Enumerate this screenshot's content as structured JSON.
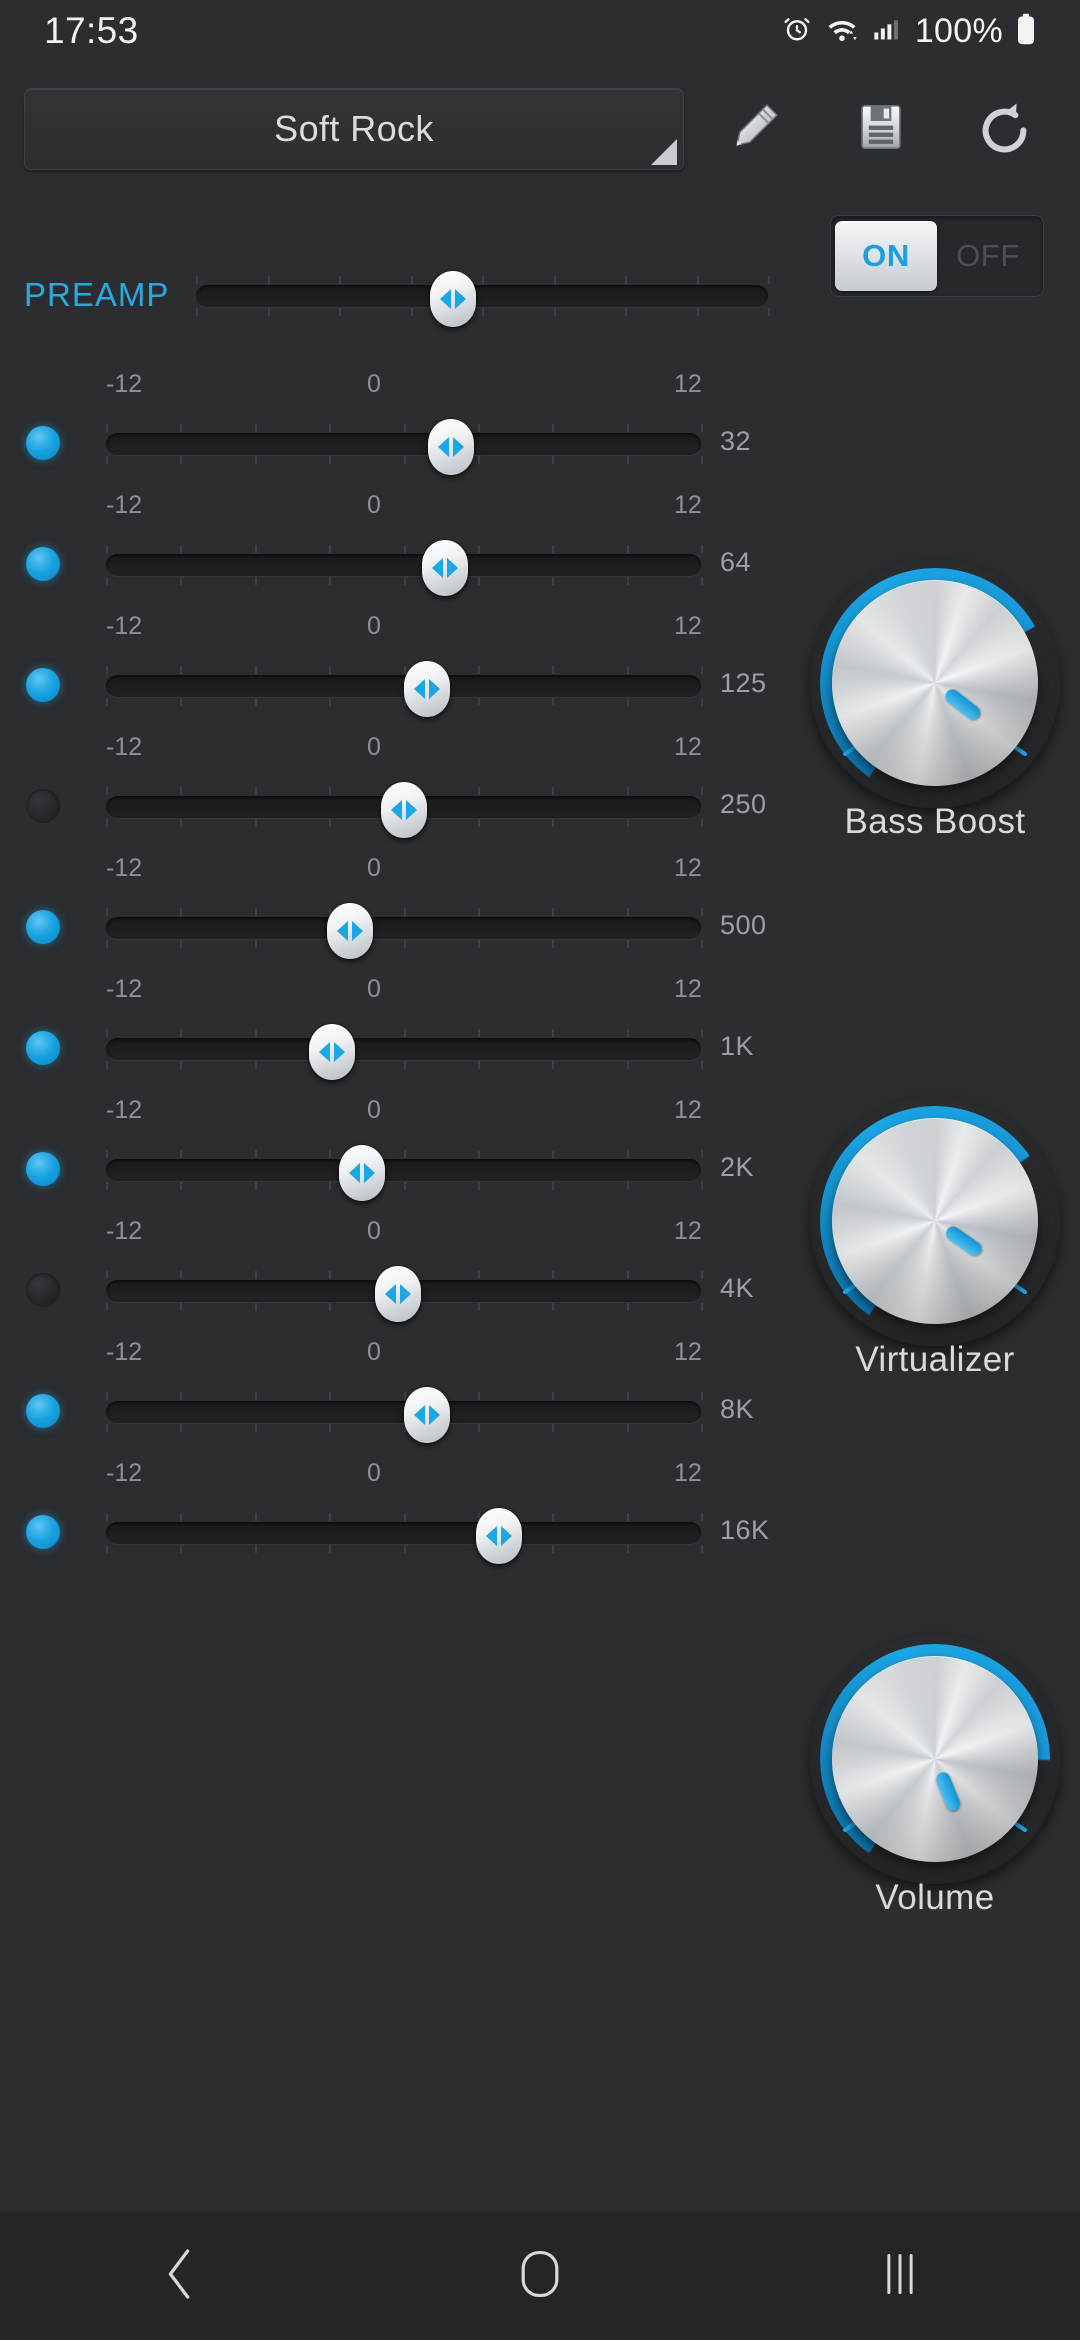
{
  "statusbar": {
    "time": "17:53",
    "battery_text": "100%",
    "icons": [
      "alarm-icon",
      "wifi-icon",
      "signal-icon",
      "battery-icon"
    ]
  },
  "toolbar": {
    "preset_name": "Soft Rock",
    "edit_label": "edit-icon",
    "save_label": "save-icon",
    "reset_label": "reset-icon"
  },
  "power": {
    "on_label": "ON",
    "off_label": "OFF",
    "state": "ON"
  },
  "preamp": {
    "label": "PREAMP",
    "position_pct": 45
  },
  "scale": {
    "min": "-12",
    "mid": "0",
    "max": "12"
  },
  "bands": [
    {
      "freq": "32",
      "position_pct": 58,
      "led": "on"
    },
    {
      "freq": "64",
      "position_pct": 57,
      "led": "on"
    },
    {
      "freq": "125",
      "position_pct": 54,
      "led": "on"
    },
    {
      "freq": "250",
      "position_pct": 50,
      "led": "off"
    },
    {
      "freq": "500",
      "position_pct": 41,
      "led": "on"
    },
    {
      "freq": "1K",
      "position_pct": 38,
      "led": "on"
    },
    {
      "freq": "2K",
      "position_pct": 43,
      "led": "on"
    },
    {
      "freq": "4K",
      "position_pct": 49,
      "led": "off"
    },
    {
      "freq": "8K",
      "position_pct": 54,
      "led": "on"
    },
    {
      "freq": "16K",
      "position_pct": 66,
      "led": "on"
    }
  ],
  "knobs": [
    {
      "label": "Bass Boost",
      "angle_deg": -52,
      "arc_deg": 205
    },
    {
      "label": "Virtualizer",
      "angle_deg": -55,
      "arc_deg": 200
    },
    {
      "label": "Volume",
      "angle_deg": -22,
      "arc_deg": 235
    }
  ],
  "navbar": {
    "back_label": "back-icon",
    "home_label": "home-icon",
    "recents_label": "recents-icon"
  },
  "colors": {
    "accent": "#1ba6e5",
    "background": "#2b2d30",
    "track": "#1a1c1e",
    "text": "#e6e6e6",
    "muted": "#8d9196"
  }
}
